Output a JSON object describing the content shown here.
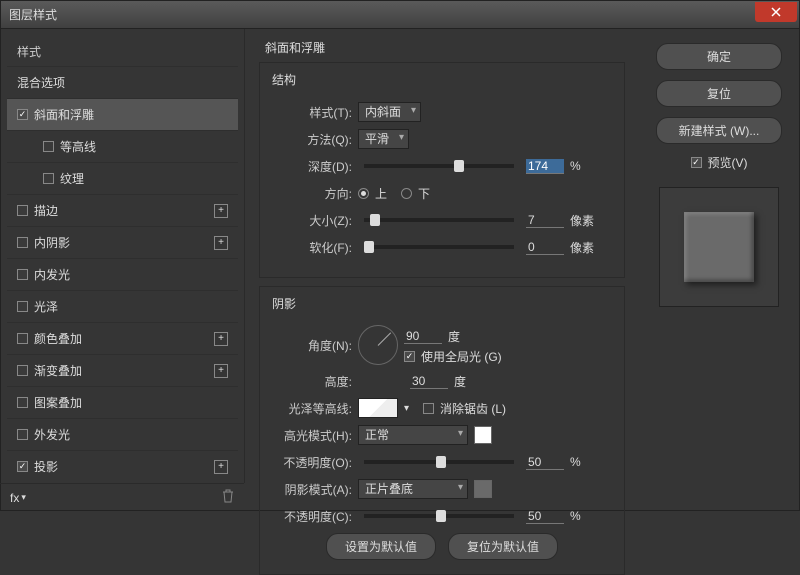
{
  "title": "图层样式",
  "sidebar": {
    "h1": "样式",
    "h2": "混合选项",
    "items": [
      {
        "label": "斜面和浮雕",
        "checked": true,
        "plus": false,
        "sub": false,
        "sel": true
      },
      {
        "label": "等高线",
        "checked": false,
        "plus": false,
        "sub": true
      },
      {
        "label": "纹理",
        "checked": false,
        "plus": false,
        "sub": true
      },
      {
        "label": "描边",
        "checked": false,
        "plus": true
      },
      {
        "label": "内阴影",
        "checked": false,
        "plus": true
      },
      {
        "label": "内发光",
        "checked": false,
        "plus": false
      },
      {
        "label": "光泽",
        "checked": false,
        "plus": false
      },
      {
        "label": "颜色叠加",
        "checked": false,
        "plus": true
      },
      {
        "label": "渐变叠加",
        "checked": false,
        "plus": true
      },
      {
        "label": "图案叠加",
        "checked": false,
        "plus": false
      },
      {
        "label": "外发光",
        "checked": false,
        "plus": false
      },
      {
        "label": "投影",
        "checked": true,
        "plus": true
      }
    ],
    "fx": "fx"
  },
  "panel": {
    "title": "斜面和浮雕",
    "structure": {
      "title": "结构",
      "style_lbl": "样式(T):",
      "style_val": "内斜面",
      "method_lbl": "方法(Q):",
      "method_val": "平滑",
      "depth_lbl": "深度(D):",
      "depth_val": "174",
      "depth_unit": "%",
      "dir_lbl": "方向:",
      "up": "上",
      "down": "下",
      "size_lbl": "大小(Z):",
      "size_val": "7",
      "size_unit": "像素",
      "soft_lbl": "软化(F):",
      "soft_val": "0",
      "soft_unit": "像素"
    },
    "shadow": {
      "title": "阴影",
      "angle_lbl": "角度(N):",
      "angle_val": "90",
      "angle_unit": "度",
      "global": "使用全局光 (G)",
      "alt_lbl": "高度:",
      "alt_val": "30",
      "alt_unit": "度",
      "gloss_lbl": "光泽等高线:",
      "anti": "消除锯齿 (L)",
      "hl_mode_lbl": "高光模式(H):",
      "hl_mode_val": "正常",
      "hl_op_lbl": "不透明度(O):",
      "hl_op_val": "50",
      "hl_op_unit": "%",
      "sh_mode_lbl": "阴影模式(A):",
      "sh_mode_val": "正片叠底",
      "sh_op_lbl": "不透明度(C):",
      "sh_op_val": "50",
      "sh_op_unit": "%"
    },
    "defaults": {
      "set": "设置为默认值",
      "reset": "复位为默认值"
    }
  },
  "right": {
    "ok": "确定",
    "cancel": "复位",
    "new": "新建样式 (W)...",
    "preview": "预览(V)"
  }
}
